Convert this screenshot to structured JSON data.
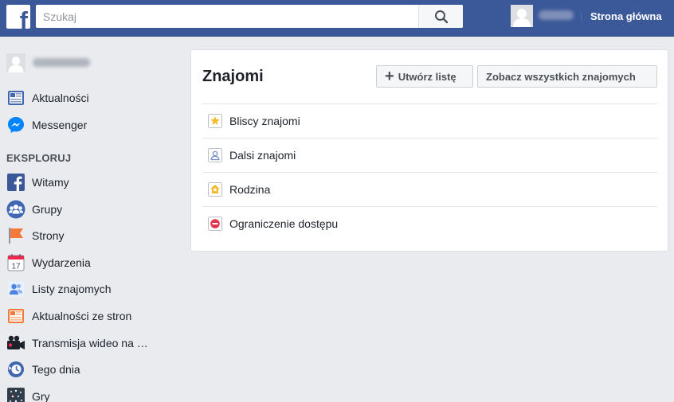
{
  "topbar": {
    "logo": "f",
    "search_placeholder": "Szukaj",
    "home_label": "Strona główna",
    "icons": {
      "logo": "facebook-logo",
      "search": "search-icon",
      "avatar": "avatar-silhouette"
    }
  },
  "sidebar": {
    "top_items": [
      {
        "label": "Aktualności",
        "icon": "news-feed-icon"
      },
      {
        "label": "Messenger",
        "icon": "messenger-icon"
      }
    ],
    "explore_title": "EKSPLORUJ",
    "explore_items": [
      {
        "label": "Witamy",
        "icon": "facebook-icon"
      },
      {
        "label": "Grupy",
        "icon": "groups-icon"
      },
      {
        "label": "Strony",
        "icon": "pages-flag-icon"
      },
      {
        "label": "Wydarzenia",
        "icon": "calendar-icon",
        "badge": "17"
      },
      {
        "label": "Listy znajomych",
        "icon": "friend-lists-icon"
      },
      {
        "label": "Aktualności ze stron",
        "icon": "pages-feed-icon"
      },
      {
        "label": "Transmisja wideo na …",
        "icon": "video-camera-icon"
      },
      {
        "label": "Tego dnia",
        "icon": "on-this-day-icon"
      },
      {
        "label": "Gry",
        "icon": "games-icon"
      }
    ]
  },
  "main": {
    "title": "Znajomi",
    "create_list_label": "Utwórz listę",
    "see_all_label": "Zobacz wszystkich znajomych",
    "lists": [
      {
        "label": "Bliscy znajomi",
        "icon": "star-icon"
      },
      {
        "label": "Dalsi znajomi",
        "icon": "person-outline-icon"
      },
      {
        "label": "Rodzina",
        "icon": "house-icon"
      },
      {
        "label": "Ograniczenie dostępu",
        "icon": "restricted-icon"
      }
    ]
  },
  "colors": {
    "brand": "#3b5998",
    "background": "#e9ebee",
    "text": "#1d2129",
    "messenger": "#0084ff",
    "restricted": "#e0364f",
    "star": "#f7b928"
  }
}
